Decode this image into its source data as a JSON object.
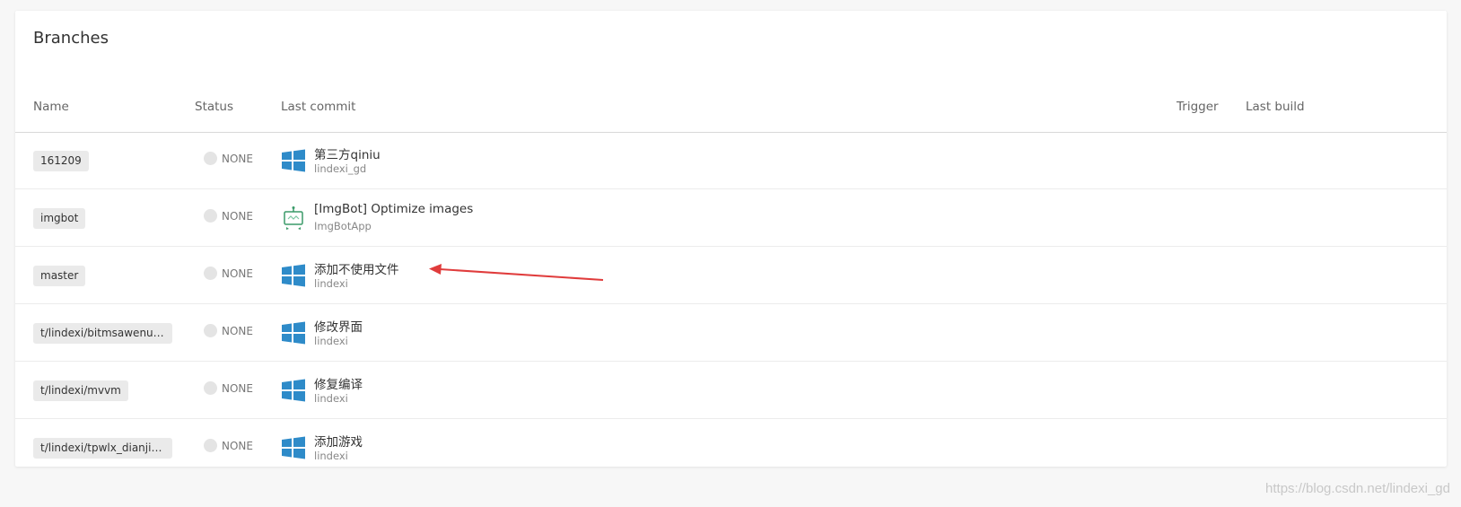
{
  "page": {
    "title": "Branches"
  },
  "table": {
    "columns": {
      "name": "Name",
      "status": "Status",
      "last_commit": "Last commit",
      "trigger": "Trigger",
      "last_build": "Last build"
    },
    "rows": [
      {
        "branch": "161209",
        "status": "NONE",
        "commit_message": "第三方qiniu",
        "commit_author": "lindexi_gd",
        "avatar_icon": "windows-logo-icon"
      },
      {
        "branch": "imgbot",
        "status": "NONE",
        "commit_message": "[ImgBot] Optimize images",
        "commit_author": "ImgBotApp",
        "avatar_icon": "imgbot-robot-icon"
      },
      {
        "branch": "master",
        "status": "NONE",
        "commit_message": "添加不使用文件",
        "commit_author": "lindexi",
        "avatar_icon": "windows-logo-icon"
      },
      {
        "branch": "t/lindexi/bitmsawenurLisvo...",
        "status": "NONE",
        "commit_message": "修改界面",
        "commit_author": "lindexi",
        "avatar_icon": "windows-logo-icon"
      },
      {
        "branch": "t/lindexi/mvvm",
        "status": "NONE",
        "commit_message": "修复编译",
        "commit_author": "lindexi",
        "avatar_icon": "windows-logo-icon"
      },
      {
        "branch": "t/lindexi/tpwlx_dianji_shenji...",
        "status": "NONE",
        "commit_message": "添加游戏",
        "commit_author": "lindexi",
        "avatar_icon": "windows-logo-icon"
      }
    ]
  },
  "annotation": {
    "arrow_color": "#e03c3c",
    "arrow_target": "master commit message"
  },
  "watermark": "https://blog.csdn.net/lindexi_gd",
  "colors": {
    "windows_logo": "#2e8bc9",
    "imgbot_green": "#3a9a68"
  }
}
